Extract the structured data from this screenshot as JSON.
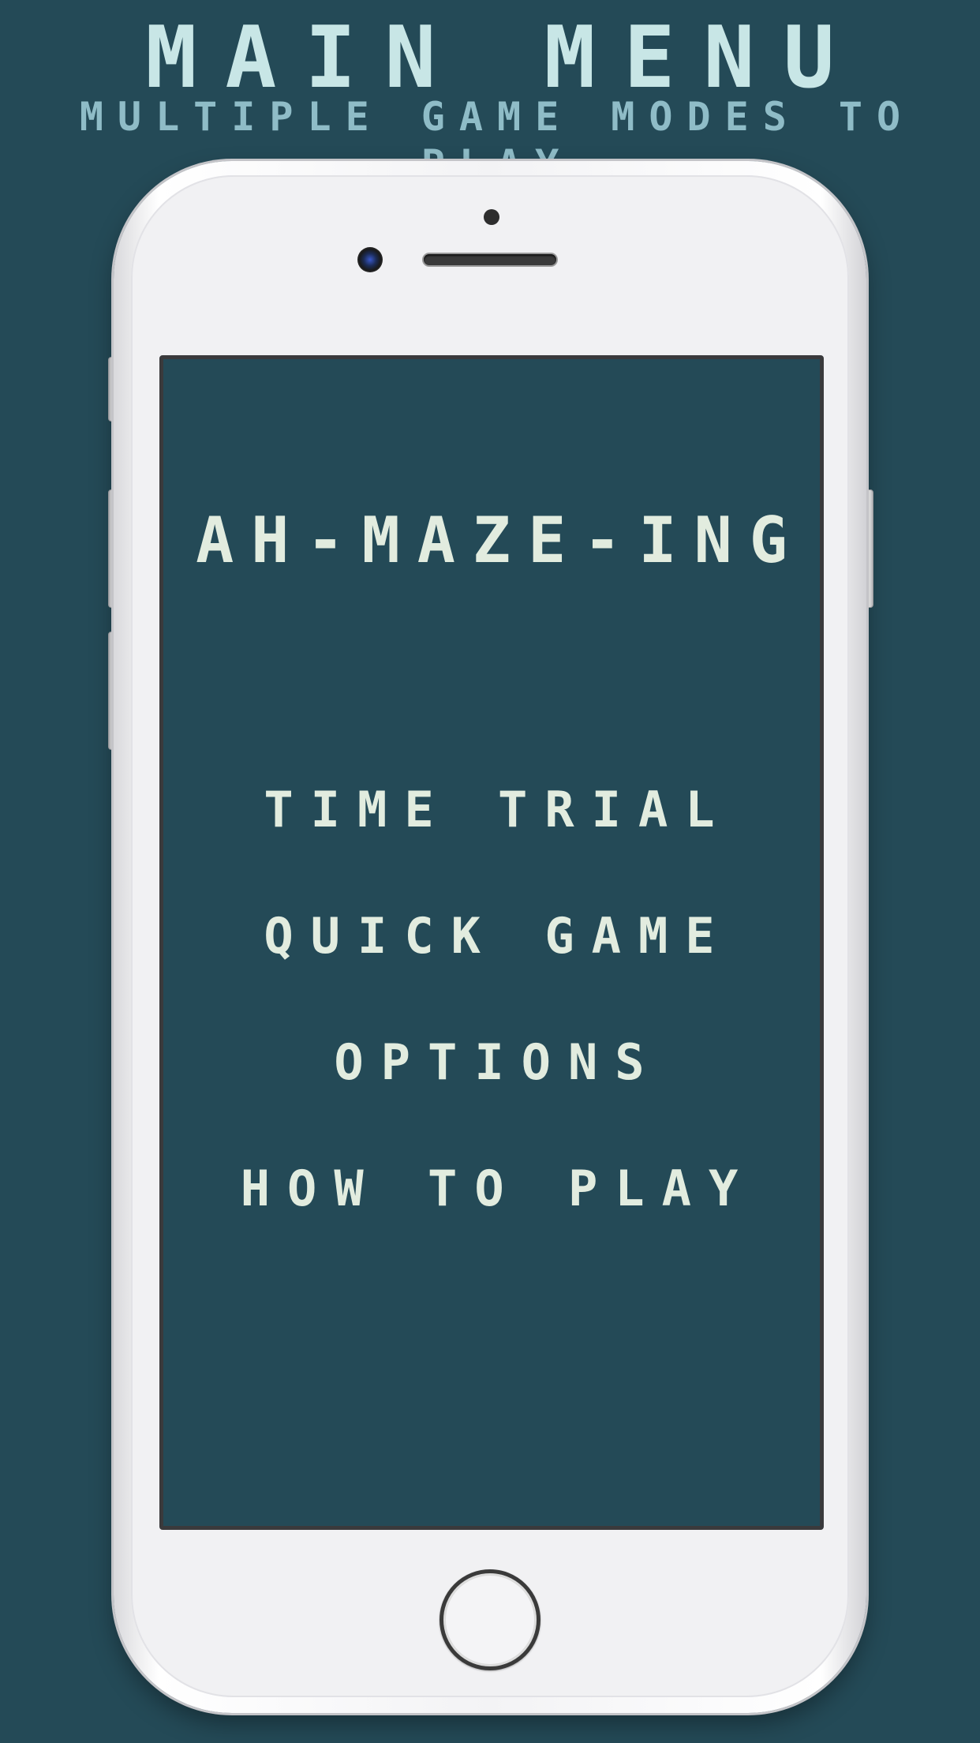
{
  "promo": {
    "title": "MAIN MENU",
    "subtitle": "MULTIPLE GAME MODES TO PLAY"
  },
  "game": {
    "title": "AH-MAZE-ING",
    "menu": [
      {
        "label": "TIME TRIAL"
      },
      {
        "label": "QUICK GAME"
      },
      {
        "label": "OPTIONS"
      },
      {
        "label": "HOW TO PLAY"
      }
    ]
  },
  "colors": {
    "background": "#244a57",
    "title_text": "#c8e6e6",
    "subtitle_text": "#8fbcc7",
    "menu_text": "#e2ecdf",
    "device_body": "#f1f1f3"
  },
  "icons": {
    "device": "iphone-white-frame",
    "home_button": "home-button-icon"
  }
}
